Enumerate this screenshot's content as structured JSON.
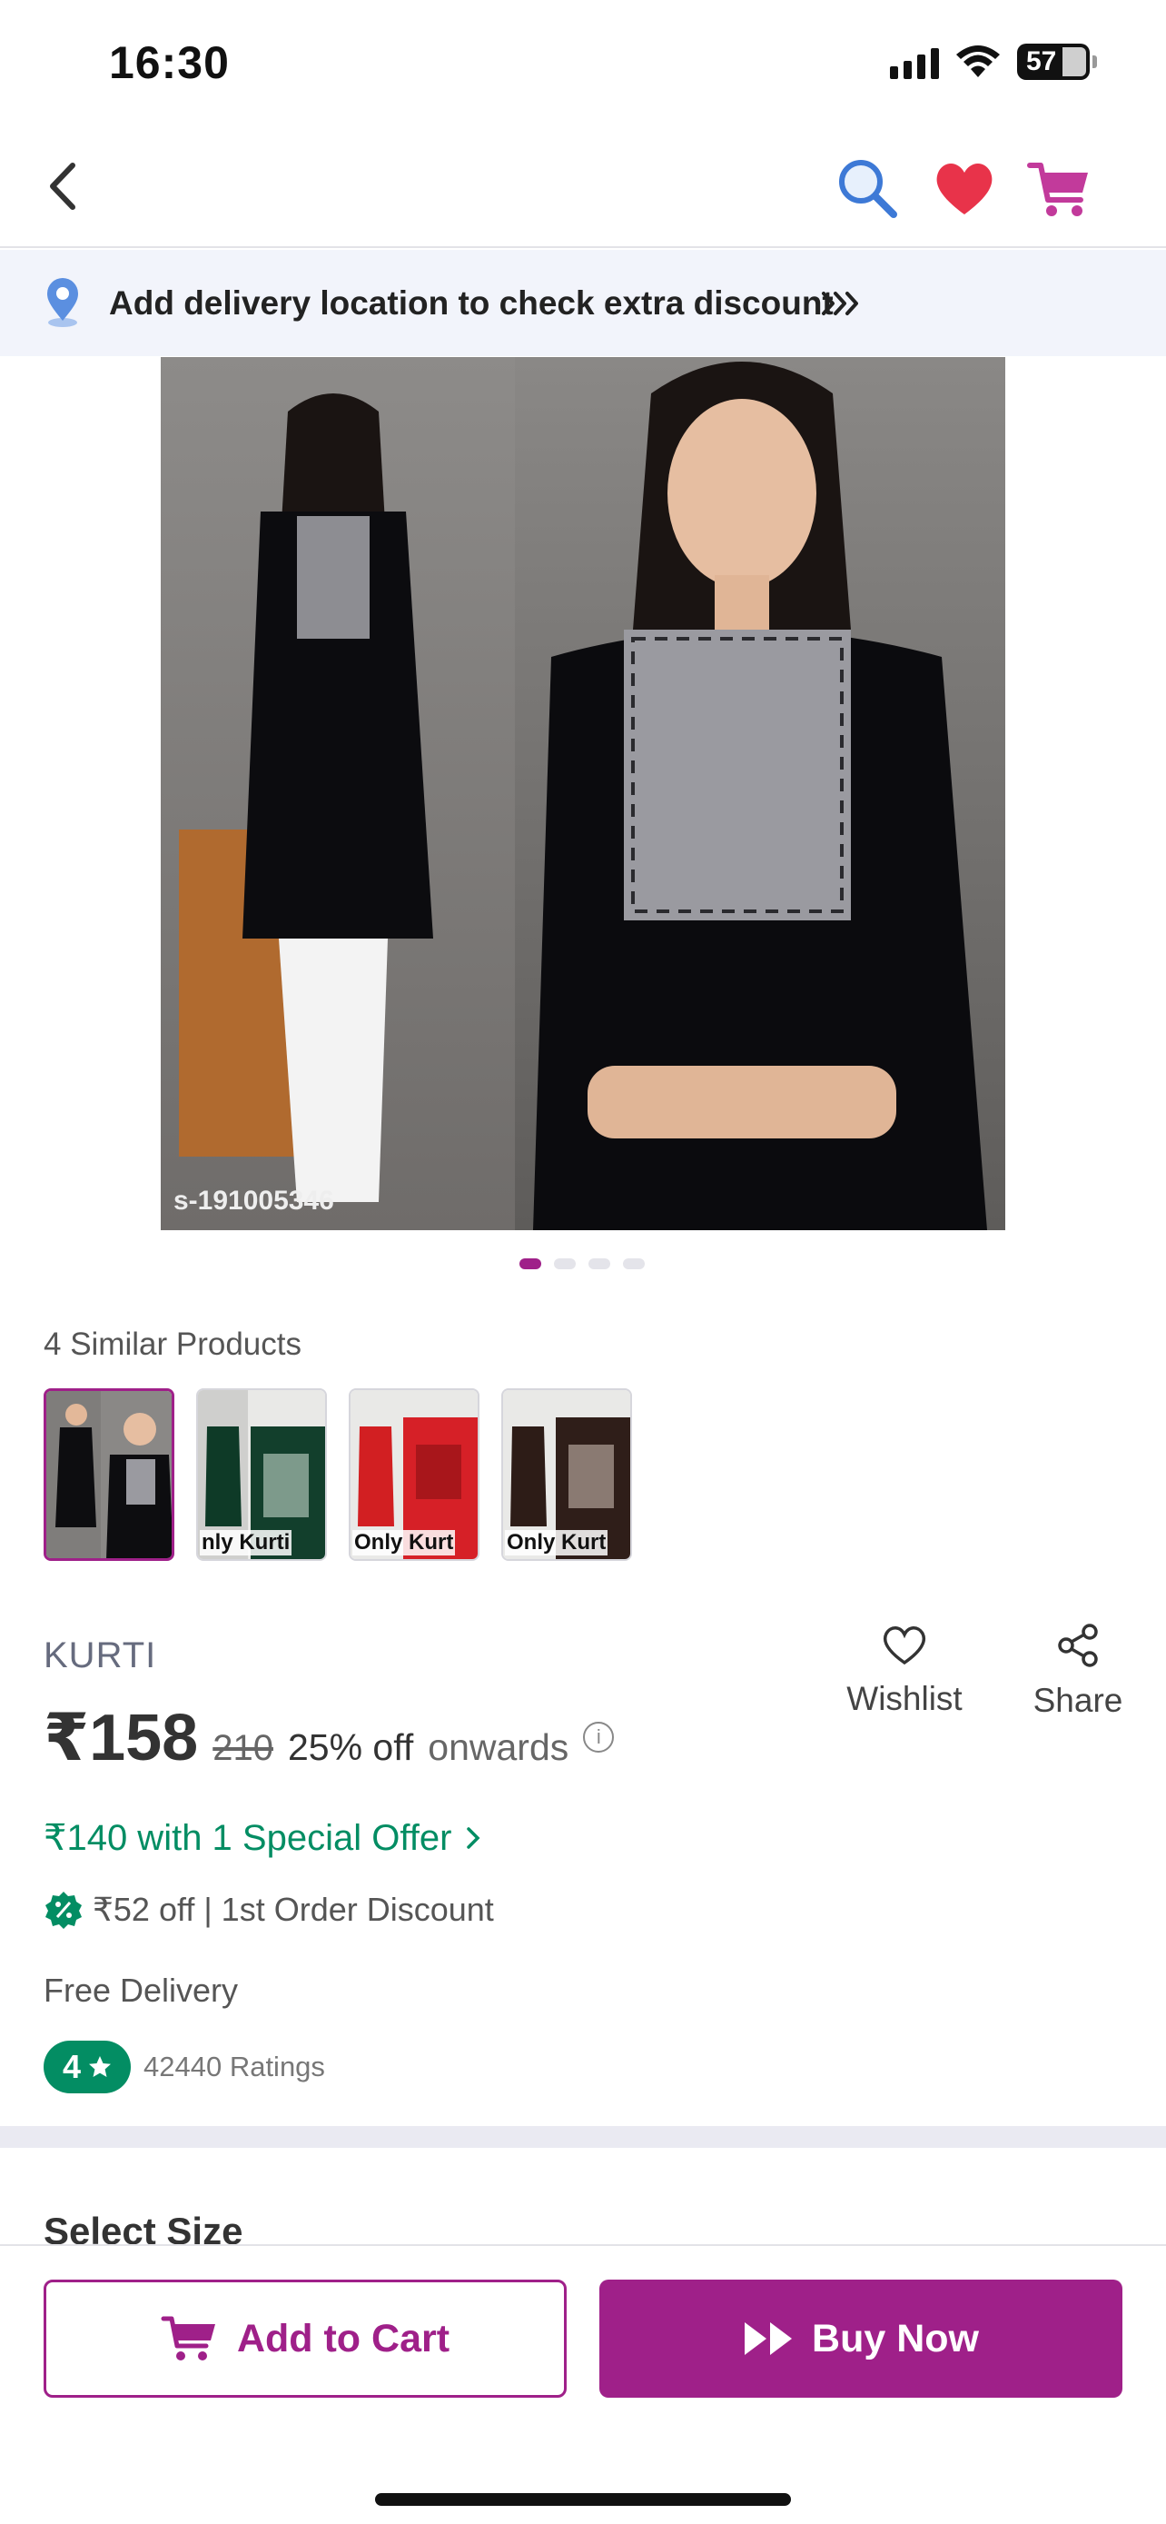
{
  "status_bar": {
    "time": "16:30",
    "battery": "57"
  },
  "location_banner": {
    "text": "Add delivery location to check extra discount"
  },
  "product_image": {
    "watermark": "s-191005346"
  },
  "carousel": {
    "total": 4,
    "active": 0
  },
  "similar": {
    "title": "4 Similar Products",
    "items": [
      {
        "caption": ""
      },
      {
        "caption": "nly Kurti"
      },
      {
        "caption": "Only Kurt"
      },
      {
        "caption": "Only Kurt"
      }
    ]
  },
  "product": {
    "category": "KURTI",
    "price": "₹158",
    "original_price": "210",
    "discount": "25% off",
    "onwards": "onwards",
    "special_offer": "₹140 with 1 Special Offer",
    "first_order": "₹52 off | 1st Order Discount",
    "delivery": "Free Delivery",
    "rating": "4",
    "ratings_count": "42440 Ratings"
  },
  "actions": {
    "wishlist": "Wishlist",
    "share": "Share"
  },
  "sections": {
    "select_size": "Select Size"
  },
  "bottom_bar": {
    "add_to_cart": "Add to Cart",
    "buy_now": "Buy Now"
  },
  "colors": {
    "accent": "#9f2089",
    "green": "#038d63",
    "heart": "#e8334a"
  }
}
